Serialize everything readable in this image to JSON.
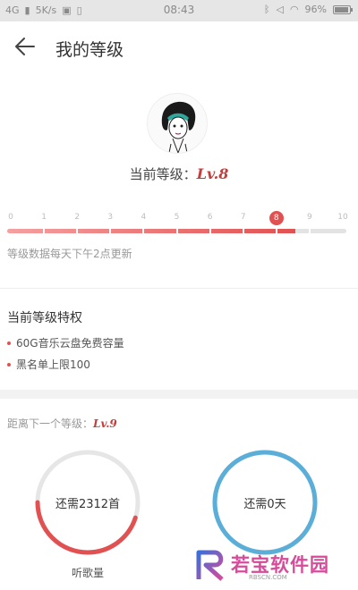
{
  "status_bar": {
    "network": "4G",
    "speed": "5K/s",
    "time": "08:43",
    "battery": "96%"
  },
  "header": {
    "title": "我的等级"
  },
  "level": {
    "prefix": "当前等级：",
    "current": "Lv.8",
    "progress_fraction": 0.85
  },
  "ticks": [
    "0",
    "1",
    "2",
    "3",
    "4",
    "5",
    "6",
    "7",
    "8",
    "9",
    "10"
  ],
  "active_tick": 8,
  "update_note": "等级数据每天下午2点更新",
  "privileges": {
    "title": "当前等级特权",
    "items": [
      "60G音乐云盘免费容量",
      "黑名单上限100"
    ]
  },
  "next_level": {
    "prefix": "距离下一个等级：",
    "level": "Lv.9"
  },
  "gauges": [
    {
      "text": "还需2312首",
      "label": "听歌量",
      "progress": 0.45,
      "color": "#e25151"
    },
    {
      "text": "还需0天",
      "label": "",
      "progress": 1.0,
      "color": "#5aaed8"
    }
  ],
  "watermark": {
    "text": "若宝软件园",
    "sub": "RBSCN.COM"
  },
  "colors": {
    "accent": "#e25151",
    "gauge_track": "#e6e6e6",
    "gauge_blue": "#5aaed8"
  }
}
